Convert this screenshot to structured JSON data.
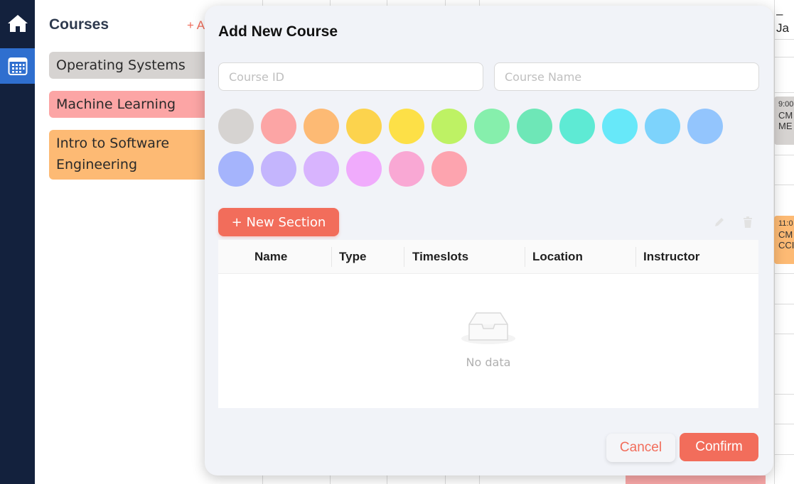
{
  "nav": {
    "items": [
      {
        "icon": "home-icon"
      },
      {
        "icon": "calendar-icon",
        "active": true
      }
    ]
  },
  "courses": {
    "title": "Courses",
    "add_label": "+ A",
    "items": [
      {
        "name": "Operating Systems",
        "color": "#d6d3d1"
      },
      {
        "name": "Machine Learning",
        "color": "#fca5a5"
      },
      {
        "name": "Intro to Software Engineering",
        "color": "#fdba74"
      }
    ]
  },
  "calendar": {
    "header_fragment": "– Ja",
    "events": [
      {
        "time": "9:00",
        "line1": "CM",
        "line2": "ME",
        "color": "#d6d3d1"
      },
      {
        "time": "11:0",
        "line1": "CM",
        "line2": "CCI",
        "color": "#fdba74"
      }
    ]
  },
  "modal": {
    "title": "Add New Course",
    "course_id_placeholder": "Course ID",
    "course_name_placeholder": "Course Name",
    "swatches": [
      "#d6d3d1",
      "#fca5a5",
      "#fdba74",
      "#fcd34d",
      "#fde047",
      "#bef264",
      "#86efac",
      "#6ee7b7",
      "#5eead4",
      "#67e8f9",
      "#7dd3fc",
      "#93c5fd",
      "#a5b4fc",
      "#c4b5fd",
      "#d8b4fe",
      "#f0abfc",
      "#f9a8d4",
      "#fda4af"
    ],
    "new_section_label": "+ New Section",
    "table": {
      "columns": [
        "Name",
        "Type",
        "Timeslots",
        "Location",
        "Instructor"
      ],
      "empty_text": "No data"
    },
    "cancel_label": "Cancel",
    "confirm_label": "Confirm"
  },
  "colors": {
    "accent": "#f26d5b",
    "nav_bg": "#13213d",
    "nav_active": "#2f6fcf"
  }
}
